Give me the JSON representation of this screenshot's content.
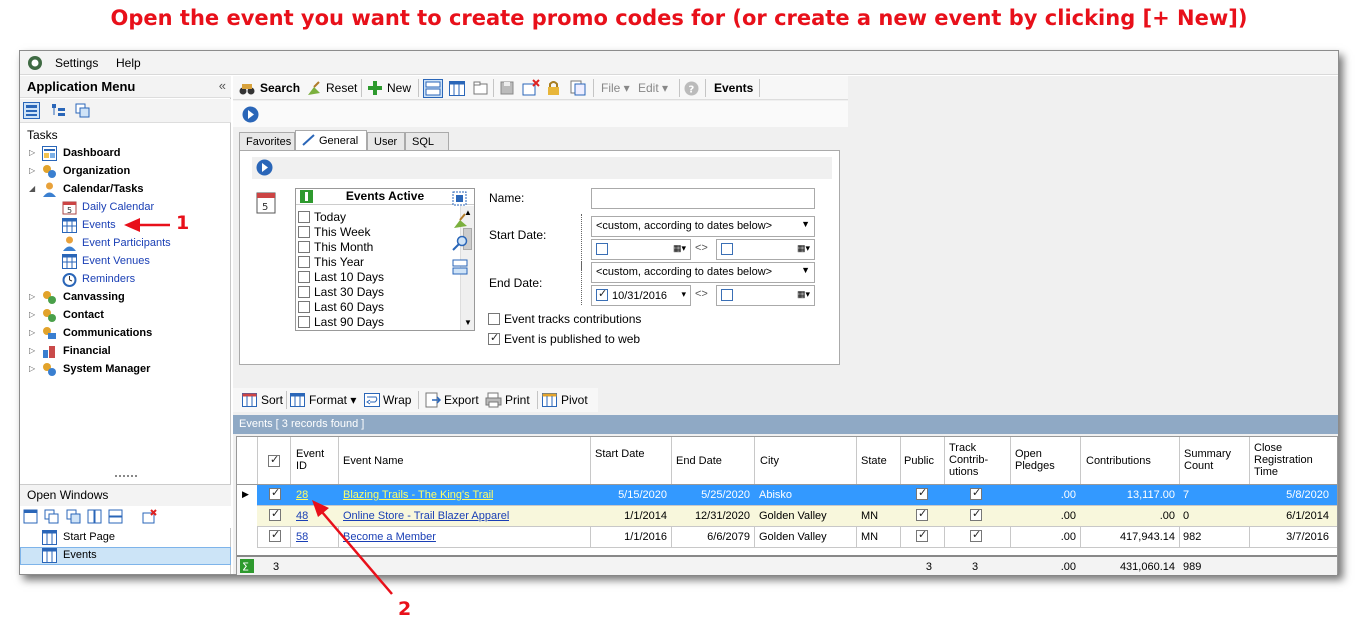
{
  "banner": "Open the event you want to create promo codes for (or create a new event by clicking [+ New])",
  "menubar": {
    "settings": "Settings",
    "help": "Help"
  },
  "left_panel": {
    "title": "Application Menu",
    "collapse": "«",
    "tasks_label": "Tasks",
    "tree": [
      {
        "label": "Dashboard"
      },
      {
        "label": "Organization"
      },
      {
        "label": "Calendar/Tasks"
      },
      {
        "label": "Daily Calendar"
      },
      {
        "label": "Events"
      },
      {
        "label": "Event Participants"
      },
      {
        "label": "Event Venues"
      },
      {
        "label": "Reminders"
      },
      {
        "label": "Canvassing"
      },
      {
        "label": "Contact"
      },
      {
        "label": "Communications"
      },
      {
        "label": "Financial"
      },
      {
        "label": "System Manager"
      }
    ],
    "open_windows_label": "Open Windows",
    "open_windows": [
      {
        "label": "Start Page"
      },
      {
        "label": "Events"
      }
    ]
  },
  "toolbar": {
    "search": "Search",
    "reset": "Reset",
    "new": "New",
    "file": "File",
    "edit": "Edit",
    "title": "Events"
  },
  "tabs": [
    "Favorites",
    "General",
    "User",
    "SQL"
  ],
  "filter": {
    "active_title": "Events Active",
    "active_options": [
      "Today",
      "This Week",
      "This Month",
      "This Year",
      "Last 10 Days",
      "Last 30 Days",
      "Last 60 Days",
      "Last 90 Days"
    ],
    "name_label": "Name:",
    "name_value": "",
    "start_label": "Start Date:",
    "start_mode": "<custom, according to dates below>",
    "end_label": "End Date:",
    "end_mode": "<custom, according to dates below>",
    "end_from": "10/31/2016",
    "range_sep": "<>",
    "tracks_contrib": "Event tracks contributions",
    "published_web": "Event is published to web"
  },
  "grid_toolbar": {
    "sort": "Sort",
    "format": "Format",
    "wrap": "Wrap",
    "export": "Export",
    "print": "Print",
    "pivot": "Pivot"
  },
  "grid": {
    "title": "Events [ 3 records found ]",
    "headers": {
      "event_id": "Event ID",
      "event_name": "Event Name",
      "start_date": "Start Date",
      "end_date": "End Date",
      "city": "City",
      "state": "State",
      "public": "Public",
      "track": "Track Contrib-utions",
      "open_pledges": "Open Pledges",
      "contributions": "Contributions",
      "summary_count": "Summary Count",
      "close_reg": "Close Registration Time"
    },
    "rows": [
      {
        "id": "28",
        "name": "Blazing Trails - The King's Trail",
        "start": "5/15/2020",
        "end": "5/25/2020",
        "city": "Abisko",
        "state": "",
        "pledges": ".00",
        "contrib": "13,117.00",
        "count": "7",
        "close": "5/8/2020"
      },
      {
        "id": "48",
        "name": "Online Store - Trail Blazer Apparel",
        "start": "1/1/2014",
        "end": "12/31/2020",
        "city": "Golden Valley",
        "state": "MN",
        "pledges": ".00",
        "contrib": ".00",
        "count": "0",
        "close": "6/1/2014"
      },
      {
        "id": "58",
        "name": "Become a Member",
        "start": "1/1/2016",
        "end": "6/6/2079",
        "city": "Golden Valley",
        "state": "MN",
        "pledges": ".00",
        "contrib": "417,943.14",
        "count": "982",
        "close": "3/7/2016"
      }
    ],
    "footer": {
      "count": "3",
      "public": "3",
      "track": "3",
      "pledges": ".00",
      "contrib": "431,060.14",
      "summary": "989"
    }
  },
  "annotations": {
    "one": "1",
    "two": "2"
  },
  "colors": {
    "accent": "#e8101a",
    "selection": "#3399ff",
    "grid_title": "#8fa9c5"
  }
}
